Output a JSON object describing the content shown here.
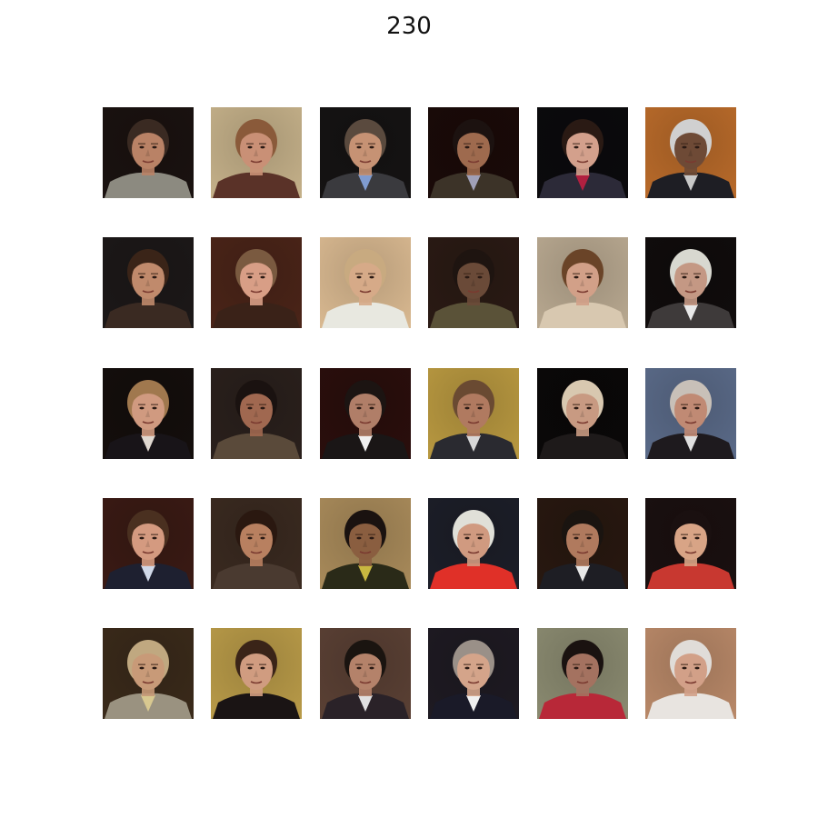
{
  "figure": {
    "title": "230"
  },
  "images": [
    {
      "bg": "#1a1210",
      "skin": "#b98266",
      "hair": "#3a2a22",
      "cloth": "#8c8a80",
      "neck": null
    },
    {
      "bg": "#c4b089",
      "skin": "#c99076",
      "hair": "#8a5a3a",
      "cloth": "#5a3228",
      "neck": null
    },
    {
      "bg": "#151313",
      "skin": "#c69274",
      "hair": "#5a4a3e",
      "cloth": "#3a3a3e",
      "neck": "#7f9bd0"
    },
    {
      "bg": "#1a0a08",
      "skin": "#9e6a4e",
      "hair": "#1c1210",
      "cloth": "#3c3328",
      "neck": "#a0a0b8"
    },
    {
      "bg": "#0b0a0d",
      "skin": "#d3a08c",
      "hair": "#2a1a14",
      "cloth": "#2c2a38",
      "neck": "#b02040"
    },
    {
      "bg": "#b86a2a",
      "skin": "#6e4a36",
      "hair": "#d0d0d0",
      "cloth": "#1e1e24",
      "neck": "#c8c8c8"
    },
    {
      "bg": "#1c1818",
      "skin": "#c08a6c",
      "hair": "#3a2418",
      "cloth": "#3a2a22",
      "neck": null
    },
    {
      "bg": "#4a2418",
      "skin": "#d89e86",
      "hair": "#7a5a40",
      "cloth": "#3a2218",
      "neck": null
    },
    {
      "bg": "#d8b890",
      "skin": "#d6aa88",
      "hair": "#c8aa80",
      "cloth": "#e8e8e0",
      "neck": null
    },
    {
      "bg": "#2a1a14",
      "skin": "#6a4a38",
      "hair": "#1e1410",
      "cloth": "#5a5238",
      "neck": null
    },
    {
      "bg": "#b8a890",
      "skin": "#d2a088",
      "hair": "#6a4428",
      "cloth": "#d8c8b0",
      "neck": null
    },
    {
      "bg": "#100c0c",
      "skin": "#c49884",
      "hair": "#d8d8d0",
      "cloth": "#3e3a3a",
      "neck": "#e8e8e8"
    },
    {
      "bg": "#140e0c",
      "skin": "#d09a80",
      "hair": "#a0784e",
      "cloth": "#181418",
      "neck": "#e0d8d0"
    },
    {
      "bg": "#2a201c",
      "skin": "#a06850",
      "hair": "#1a1210",
      "cloth": "#5a4a3a",
      "neck": null
    },
    {
      "bg": "#2a0e0c",
      "skin": "#b07e68",
      "hair": "#1c1412",
      "cloth": "#1a1616",
      "neck": "#f0f0f0"
    },
    {
      "bg": "#b89840",
      "skin": "#b07a60",
      "hair": "#6a4a32",
      "cloth": "#2a2a30",
      "neck": "#d8d8d8"
    },
    {
      "bg": "#0a0808",
      "skin": "#c89a82",
      "hair": "#d8c8b0",
      "cloth": "#1e1a1a",
      "neck": null
    },
    {
      "bg": "#5a6a88",
      "skin": "#c08a74",
      "hair": "#c8c0b8",
      "cloth": "#1e1a1e",
      "neck": "#e0e0e0"
    },
    {
      "bg": "#3a1a14",
      "skin": "#d49a80",
      "hair": "#4a3020",
      "cloth": "#1e2030",
      "neck": "#d0d8e8"
    },
    {
      "bg": "#3a2a20",
      "skin": "#b88060",
      "hair": "#2a1810",
      "cloth": "#4a3a30",
      "neck": null
    },
    {
      "bg": "#a88a5a",
      "skin": "#8a5e40",
      "hair": "#1a1210",
      "cloth": "#2a2a18",
      "neck": "#c8b840"
    },
    {
      "bg": "#1c1e28",
      "skin": "#d09a80",
      "hair": "#e0e0d8",
      "cloth": "#e03028",
      "neck": null
    },
    {
      "bg": "#281810",
      "skin": "#b07a5e",
      "hair": "#1a1410",
      "cloth": "#1e1e24",
      "neck": "#e8e8e8"
    },
    {
      "bg": "#1a1010",
      "skin": "#d8a486",
      "hair": "#1a1010",
      "cloth": "#c83830",
      "neck": null
    },
    {
      "bg": "#3a2a1a",
      "skin": "#c89a78",
      "hair": "#c0a880",
      "cloth": "#9a9280",
      "neck": "#d8c890"
    },
    {
      "bg": "#b89a48",
      "skin": "#d09c80",
      "hair": "#3a2418",
      "cloth": "#1a1414",
      "neck": null
    },
    {
      "bg": "#5a4034",
      "skin": "#b4826a",
      "hair": "#1a1410",
      "cloth": "#2a2228",
      "neck": "#e0e0e0"
    },
    {
      "bg": "#1e1a22",
      "skin": "#d4a48a",
      "hair": "#9a9088",
      "cloth": "#1a1a28",
      "neck": "#f0f0f0"
    },
    {
      "bg": "#8a8a70",
      "skin": "#a47260",
      "hair": "#1a1210",
      "cloth": "#b82838",
      "neck": null
    },
    {
      "bg": "#b88868",
      "skin": "#d2a088",
      "hair": "#e0dcd8",
      "cloth": "#e8e4e0",
      "neck": null
    }
  ]
}
